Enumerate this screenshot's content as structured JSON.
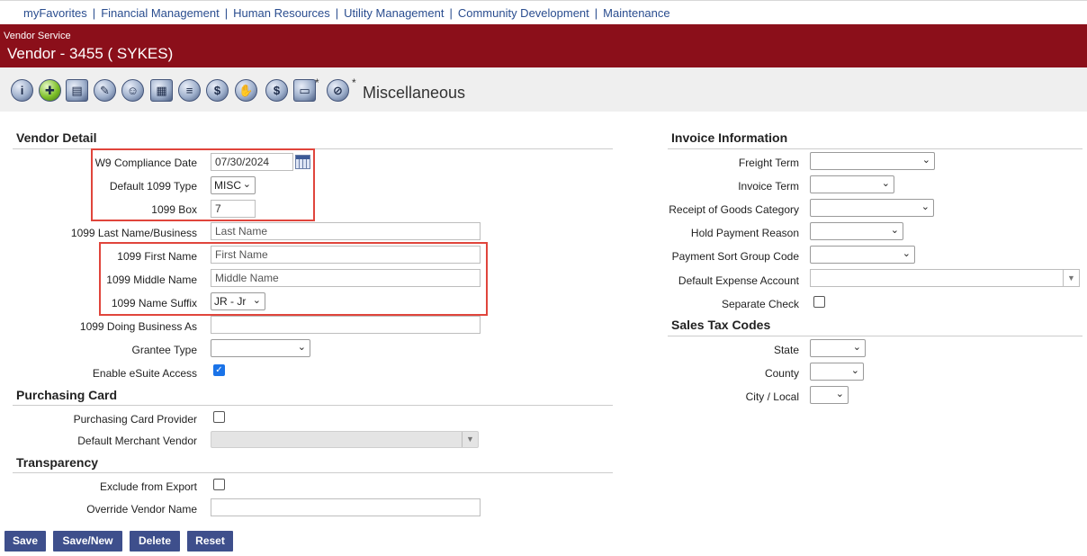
{
  "nav": {
    "items": [
      "myFavorites",
      "Financial Management",
      "Human Resources",
      "Utility Management",
      "Community Development",
      "Maintenance"
    ]
  },
  "header": {
    "subtitle": "Vendor Service",
    "title": "Vendor - 3455 ( SYKES)"
  },
  "toolbar": {
    "icons": [
      "info-icon",
      "puzzle-icon",
      "id-card-icon",
      "contact-icon",
      "person-icon",
      "report-icon",
      "stack-icon",
      "money-icon",
      "handshake-icon",
      "dollar-icon",
      "document-icon",
      "no-icon"
    ],
    "star": "*",
    "active_label": "Miscellaneous"
  },
  "vendor_detail": {
    "title": "Vendor Detail",
    "w9_label": "W9 Compliance Date",
    "w9_value": "07/30/2024",
    "type1099_label": "Default 1099 Type",
    "type1099_value": "MISC",
    "box1099_label": "1099 Box",
    "box1099_value": "7",
    "last_label": "1099 Last Name/Business",
    "last_placeholder": "Last Name",
    "first_label": "1099 First Name",
    "first_placeholder": "First Name",
    "middle_label": "1099 Middle Name",
    "middle_placeholder": "Middle Name",
    "suffix_label": "1099 Name Suffix",
    "suffix_value": "JR - Jr",
    "dba_label": "1099 Doing Business As",
    "dba_value": "",
    "grantee_label": "Grantee Type",
    "grantee_value": "",
    "esuite_label": "Enable eSuite Access",
    "esuite_checked": true
  },
  "purchasing_card": {
    "title": "Purchasing Card",
    "provider_label": "Purchasing Card Provider",
    "provider_checked": false,
    "merchant_label": "Default Merchant Vendor",
    "merchant_value": ""
  },
  "transparency": {
    "title": "Transparency",
    "exclude_label": "Exclude from Export",
    "exclude_checked": false,
    "override_label": "Override Vendor Name",
    "override_value": ""
  },
  "invoice_info": {
    "title": "Invoice Information",
    "freight_label": "Freight Term",
    "invoice_term_label": "Invoice Term",
    "receipt_label": "Receipt of Goods Category",
    "hold_label": "Hold Payment Reason",
    "sort_label": "Payment Sort Group Code",
    "expense_label": "Default Expense Account",
    "separate_label": "Separate Check",
    "separate_checked": false
  },
  "sales_tax": {
    "title": "Sales Tax Codes",
    "state_label": "State",
    "county_label": "County",
    "city_label": "City / Local"
  },
  "buttons": {
    "save": "Save",
    "save_new": "Save/New",
    "delete": "Delete",
    "reset": "Reset"
  },
  "colors": {
    "header_bg": "#8b0f1a",
    "button_bg": "#3e4f8c",
    "highlight": "#e0453c",
    "link": "#2a4d8f"
  }
}
